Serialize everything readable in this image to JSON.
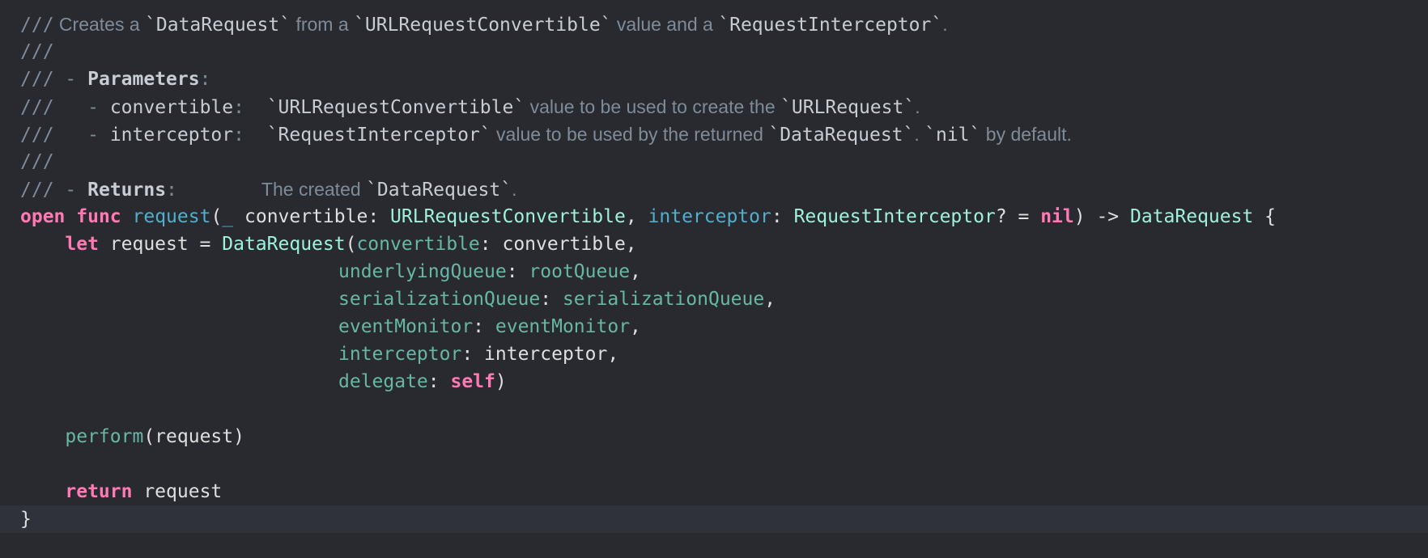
{
  "doc_comment": {
    "slashes": "///",
    "line1": {
      "prefix": " Creates a ",
      "t1": "`DataRequest`",
      "mid1": " from a ",
      "t2": "`URLRequestConvertible`",
      "mid2": " value and a ",
      "t3": "`RequestInterceptor`",
      "end": "."
    },
    "dash": "-",
    "parameters_label": "Parameters",
    "colon": ":",
    "param1": {
      "name": "convertible",
      "t1": "`URLRequestConvertible`",
      "desc1": " value to be used to create the ",
      "t2": "`URLRequest`",
      "end": "."
    },
    "param2": {
      "name": "interceptor",
      "t1": "`RequestInterceptor`",
      "desc1": " value to be used by the returned ",
      "t2": "`DataRequest`",
      "sep": ". ",
      "t3": "`nil`",
      "desc2": " by default."
    },
    "returns_label": "Returns",
    "returns_desc": "The created ",
    "returns_type": "`DataRequest`",
    "returns_end": "."
  },
  "code": {
    "kw_open": "open",
    "kw_func": "func",
    "func_name": "request",
    "paren_open": "(",
    "underscore": "_",
    "param_convertible": " convertible: ",
    "type_convertible": "URLRequestConvertible",
    "comma": ", ",
    "label_interceptor": "interceptor",
    "colon_sp": ": ",
    "type_interceptor": "RequestInterceptor",
    "optional_default": "? = ",
    "kw_nil": "nil",
    "arrow": ") -> ",
    "return_type": "DataRequest",
    "brace_open": " {",
    "kw_let": "let",
    "let_rest": " request = ",
    "init_type": "DataRequest",
    "arg_convertible_label": "convertible",
    "arg_convertible_value": ": convertible,",
    "arg_queue_label": "underlyingQueue",
    "arg_queue_value": "rootQueue",
    "arg_serial_label": "serializationQueue",
    "arg_serial_value": "serializationQueue",
    "arg_monitor_label": "eventMonitor",
    "arg_monitor_value": "eventMonitor",
    "arg_interceptor_label": "interceptor",
    "arg_interceptor_value": ": interceptor,",
    "arg_delegate_label": "delegate",
    "kw_self": "self",
    "close_paren": ")",
    "perform_call": "perform",
    "perform_args": "(request)",
    "kw_return": "return",
    "return_value": " request",
    "brace_close": "}"
  },
  "colors": {
    "background": "#292A30",
    "current_line": "#2F3239",
    "keyword": "#FF7AB2",
    "function_declaration": "#4EB0CC",
    "type": "#9EF1DD",
    "project_identifier": "#67B7A4",
    "plain": "#DFDFE0",
    "comment": "#7F8C98"
  }
}
